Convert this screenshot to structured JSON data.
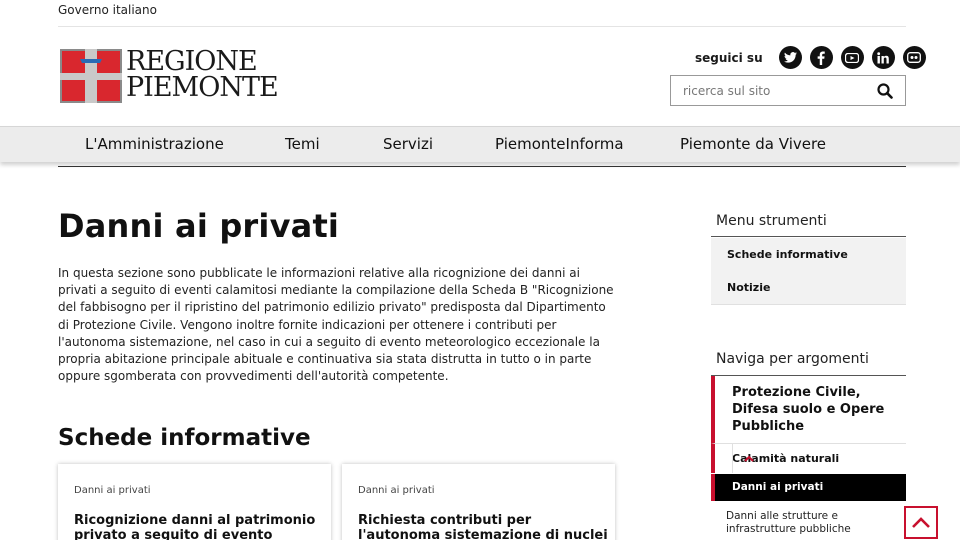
{
  "topbar": {
    "label": "Governo italiano"
  },
  "logo": {
    "line1": "REGIONE",
    "line2": "PIEMONTE",
    "colors": {
      "red": "#d9272e",
      "grey": "#8a8a8a"
    }
  },
  "social": {
    "label": "seguici su",
    "icons": [
      "twitter-icon",
      "facebook-icon",
      "youtube-icon",
      "linkedin-icon",
      "flickr-icon"
    ]
  },
  "search": {
    "placeholder": "ricerca sul sito",
    "icon": "search-icon"
  },
  "nav": {
    "items": [
      "L'Amministrazione",
      "Temi",
      "Servizi",
      "PiemonteInforma",
      "Piemonte da Vivere"
    ]
  },
  "main": {
    "title": "Danni ai privati",
    "intro": "In questa sezione sono pubblicate le informazioni relative  alla ricognizione dei danni ai privati a seguito di eventi calamitosi mediante la compilazione della Scheda B \"Ricognizione del fabbisogno per il ripristino del patrimonio edilizio privato\" predisposta dal Dipartimento di Protezione Civile. Vengono inoltre fornite indicazioni per ottenere i contributi per l'autonoma sistemazione, nel caso in cui  a seguito di evento meteorologico eccezionale la propria abitazione principale abituale e continuativa sia stata distrutta in tutto o in parte oppure sgomberata con provvedimenti dell'autorità competente.",
    "section_title": "Schede informative",
    "cards": [
      {
        "category": "Danni ai privati",
        "title": "Ricognizione danni al patrimonio privato a seguito di evento"
      },
      {
        "category": "Danni ai privati",
        "title": "Richiesta contributi per l'autonoma sistemazione di nuclei evacuati"
      }
    ]
  },
  "sidebar": {
    "menu_title": "Menu strumenti",
    "menu_items": [
      "Schede informative",
      "Notizie"
    ],
    "topics_title": "Naviga per argomenti",
    "topic": "Protezione Civile, Difesa suolo e Opere Pubbliche",
    "subtopic": "Calamità naturali",
    "active": "Danni ai privati",
    "child": "Danni alle strutture e infrastrutture pubbliche"
  },
  "accent_color": "#c8102e"
}
